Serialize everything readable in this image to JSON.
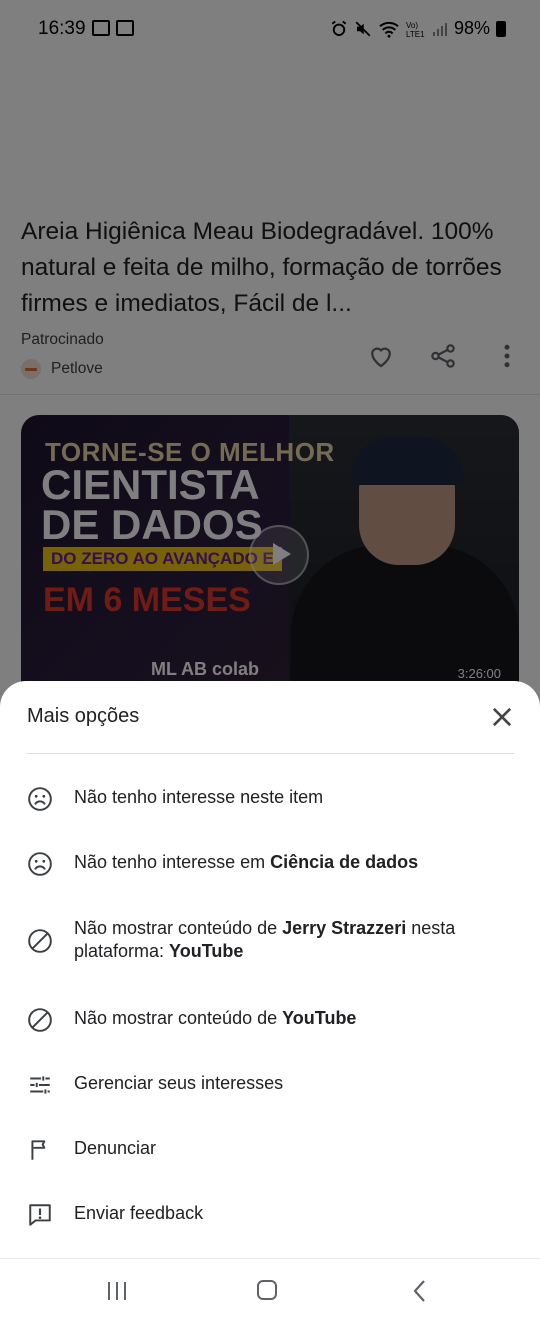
{
  "status_bar": {
    "time": "16:39",
    "battery": "98%"
  },
  "feed": {
    "headline": "Areia Higiênica Meau Biodegradável. 100% natural e feita de milho, formação de torrões firmes e imediatos, Fácil de l...",
    "sponsored_label": "Patrocinado",
    "source_name": "Petlove",
    "video": {
      "thumb_line1": "TORNE-SE O MELHOR",
      "thumb_line2": "CIENTISTA",
      "thumb_line3": "DE DADOS",
      "thumb_line4": "DO ZERO AO AVANÇADO E",
      "thumb_line5": "EM 6 MESES",
      "thumb_tools": "ML AB colab",
      "duration": "3:26:00"
    }
  },
  "sheet": {
    "title": "Mais opções",
    "options": [
      {
        "icon": "sad-face-icon",
        "text": "Não tenho interesse neste item",
        "bold": ""
      },
      {
        "icon": "sad-face-icon",
        "text": "Não tenho interesse em ",
        "bold": "Ciência de dados"
      },
      {
        "icon": "block-icon",
        "text": "Não mostrar conteúdo de ",
        "bold": "Jerry Strazzeri",
        "text2": " nesta plataforma: ",
        "bold2": "YouTube"
      },
      {
        "icon": "block-icon",
        "text": "Não mostrar conteúdo de ",
        "bold": "YouTube"
      },
      {
        "icon": "tune-icon",
        "text": "Gerenciar seus interesses",
        "bold": ""
      },
      {
        "icon": "flag-icon",
        "text": "Denunciar",
        "bold": ""
      },
      {
        "icon": "feedback-icon",
        "text": "Enviar feedback",
        "bold": ""
      }
    ]
  }
}
